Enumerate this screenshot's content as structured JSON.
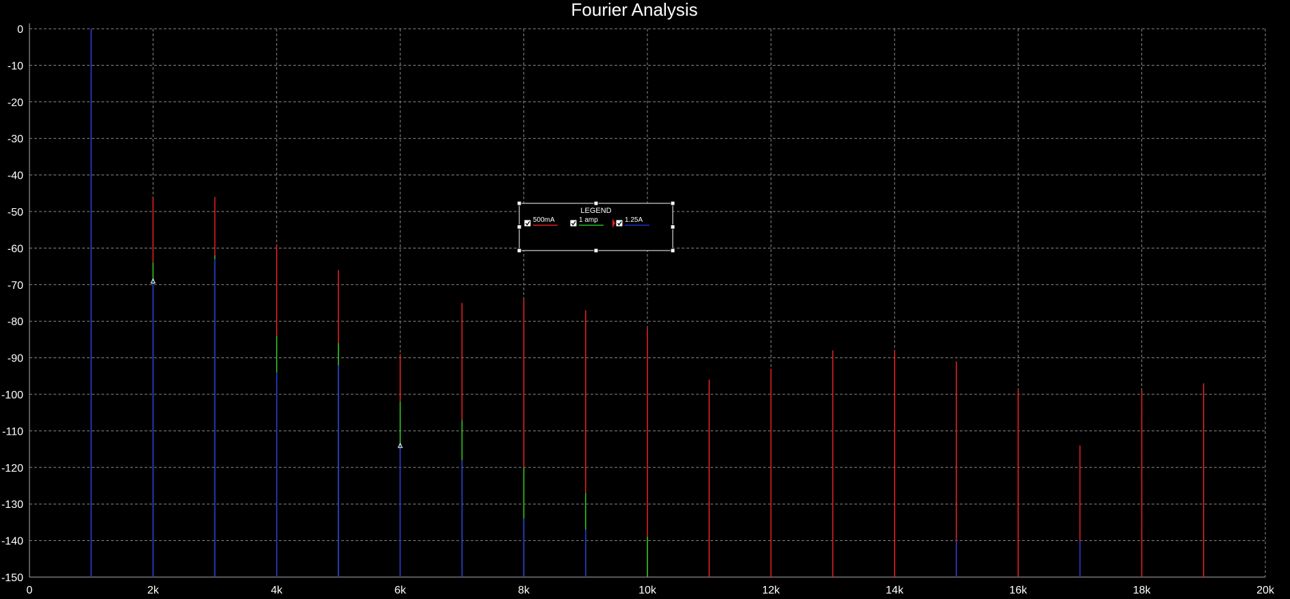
{
  "chart_data": {
    "type": "bar",
    "title": "Fourier Analysis",
    "xlabel": "",
    "ylabel": "",
    "xlim": [
      0,
      20000
    ],
    "ylim": [
      -150,
      0
    ],
    "grid": true,
    "background": "#000000",
    "x_ticks": [
      {
        "value": 0,
        "label": "0"
      },
      {
        "value": 2000,
        "label": "2k"
      },
      {
        "value": 4000,
        "label": "4k"
      },
      {
        "value": 6000,
        "label": "6k"
      },
      {
        "value": 8000,
        "label": "8k"
      },
      {
        "value": 10000,
        "label": "10k"
      },
      {
        "value": 12000,
        "label": "12k"
      },
      {
        "value": 14000,
        "label": "14k"
      },
      {
        "value": 16000,
        "label": "16k"
      },
      {
        "value": 18000,
        "label": "18k"
      },
      {
        "value": 20000,
        "label": "20k"
      }
    ],
    "y_ticks": [
      {
        "value": 0,
        "label": "0"
      },
      {
        "value": -10,
        "label": "-10"
      },
      {
        "value": -20,
        "label": "-20"
      },
      {
        "value": -30,
        "label": "-30"
      },
      {
        "value": -40,
        "label": "-40"
      },
      {
        "value": -50,
        "label": "-50"
      },
      {
        "value": -60,
        "label": "-60"
      },
      {
        "value": -70,
        "label": "-70"
      },
      {
        "value": -80,
        "label": "-80"
      },
      {
        "value": -90,
        "label": "-90"
      },
      {
        "value": -100,
        "label": "-100"
      },
      {
        "value": -110,
        "label": "-110"
      },
      {
        "value": -120,
        "label": "-120"
      },
      {
        "value": -130,
        "label": "-130"
      },
      {
        "value": -140,
        "label": "-140"
      },
      {
        "value": -150,
        "label": "-150"
      }
    ],
    "legend": {
      "title": "LEGEND",
      "placement": "center"
    },
    "series": [
      {
        "name": "500mA",
        "color": "#e02020",
        "points": [
          {
            "x": 1000,
            "y": 0
          },
          {
            "x": 2000,
            "y": -46
          },
          {
            "x": 3000,
            "y": -46
          },
          {
            "x": 4000,
            "y": -59
          },
          {
            "x": 5000,
            "y": -66
          },
          {
            "x": 6000,
            "y": -89
          },
          {
            "x": 7000,
            "y": -75
          },
          {
            "x": 8000,
            "y": -74
          },
          {
            "x": 9000,
            "y": -77
          },
          {
            "x": 10000,
            "y": -82
          },
          {
            "x": 11000,
            "y": -96
          },
          {
            "x": 12000,
            "y": -93
          },
          {
            "x": 13000,
            "y": -88
          },
          {
            "x": 14000,
            "y": -88
          },
          {
            "x": 15000,
            "y": -91
          },
          {
            "x": 16000,
            "y": -99
          },
          {
            "x": 17000,
            "y": -114
          },
          {
            "x": 18000,
            "y": -99
          },
          {
            "x": 19000,
            "y": -97
          }
        ]
      },
      {
        "name": "1 amp",
        "color": "#20c020",
        "points": [
          {
            "x": 1000,
            "y": 0
          },
          {
            "x": 2000,
            "y": -64
          },
          {
            "x": 3000,
            "y": -62
          },
          {
            "x": 4000,
            "y": -84
          },
          {
            "x": 5000,
            "y": -86
          },
          {
            "x": 6000,
            "y": -102
          },
          {
            "x": 7000,
            "y": -107
          },
          {
            "x": 8000,
            "y": -120
          },
          {
            "x": 9000,
            "y": -127
          },
          {
            "x": 10000,
            "y": -139
          }
        ]
      },
      {
        "name": "1.25A",
        "color": "#2030d0",
        "points": [
          {
            "x": 1000,
            "y": 0
          },
          {
            "x": 2000,
            "y": -69
          },
          {
            "x": 3000,
            "y": -63
          },
          {
            "x": 4000,
            "y": -94
          },
          {
            "x": 5000,
            "y": -92
          },
          {
            "x": 6000,
            "y": -114
          },
          {
            "x": 7000,
            "y": -118
          },
          {
            "x": 8000,
            "y": -134
          },
          {
            "x": 9000,
            "y": -137
          },
          {
            "x": 15000,
            "y": -140
          },
          {
            "x": 17000,
            "y": -140
          }
        ]
      }
    ]
  }
}
